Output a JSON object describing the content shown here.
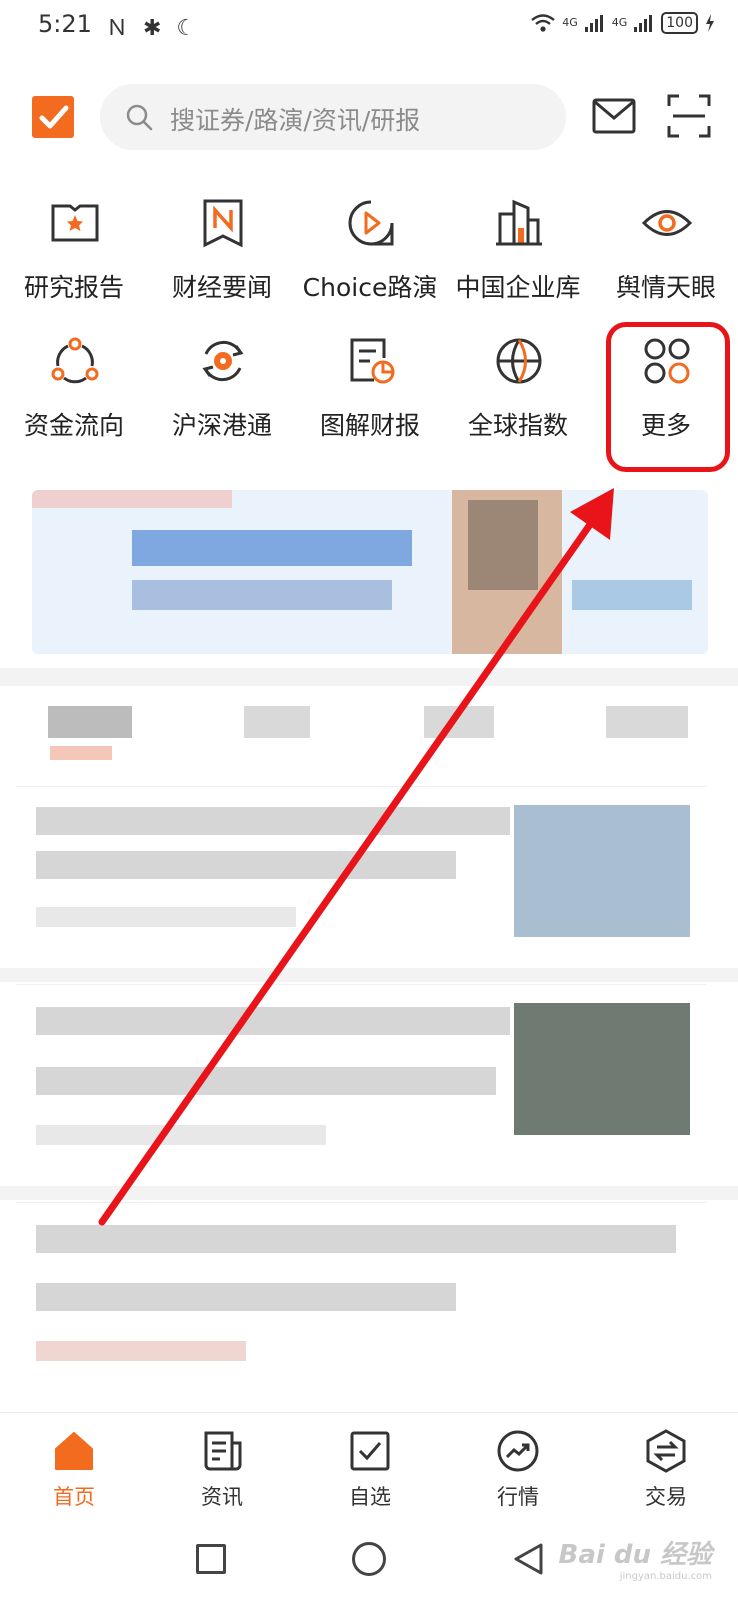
{
  "status_bar": {
    "time": "5:21",
    "network": "4G",
    "battery": "100"
  },
  "top_bar": {
    "search_placeholder": "搜证券/路演/资讯/研报",
    "logo_icon": "checkbox-logo-icon",
    "mail_icon": "mail-icon",
    "scan_icon": "scan-icon"
  },
  "grid": [
    {
      "label": "研究报告",
      "icon": "star-book-icon"
    },
    {
      "label": "财经要闻",
      "icon": "news-bookmark-icon"
    },
    {
      "label": "Choice路演",
      "icon": "play-bubble-icon"
    },
    {
      "label": "中国企业库",
      "icon": "buildings-icon"
    },
    {
      "label": "舆情天眼",
      "icon": "eye-icon"
    },
    {
      "label": "资金流向",
      "icon": "flow-circle-icon"
    },
    {
      "label": "沪深港通",
      "icon": "hk-connect-icon"
    },
    {
      "label": "图解财报",
      "icon": "chart-doc-icon"
    },
    {
      "label": "全球指数",
      "icon": "globe-icon"
    },
    {
      "label": "更多",
      "icon": "more-circles-icon"
    }
  ],
  "bottom_nav": [
    {
      "label": "首页",
      "icon": "home-icon",
      "active": true
    },
    {
      "label": "资讯",
      "icon": "news-icon",
      "active": false
    },
    {
      "label": "自选",
      "icon": "checklist-icon",
      "active": false
    },
    {
      "label": "行情",
      "icon": "trend-icon",
      "active": false
    },
    {
      "label": "交易",
      "icon": "exchange-icon",
      "active": false
    }
  ],
  "watermark": {
    "text": "Bai du 经验",
    "subtext": "jingyan.baidu.com"
  },
  "colors": {
    "accent": "#f26b1f",
    "highlight": "#e8141a",
    "icon_dark": "#333333"
  }
}
